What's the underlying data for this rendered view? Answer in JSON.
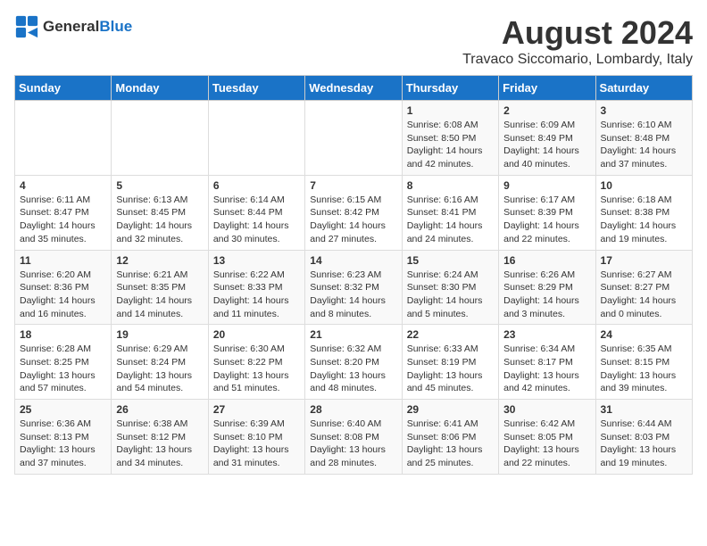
{
  "logo": {
    "text_general": "General",
    "text_blue": "Blue"
  },
  "header": {
    "month_year": "August 2024",
    "location": "Travaco Siccomario, Lombardy, Italy"
  },
  "days_of_week": [
    "Sunday",
    "Monday",
    "Tuesday",
    "Wednesday",
    "Thursday",
    "Friday",
    "Saturday"
  ],
  "weeks": [
    [
      {
        "day": "",
        "info": ""
      },
      {
        "day": "",
        "info": ""
      },
      {
        "day": "",
        "info": ""
      },
      {
        "day": "",
        "info": ""
      },
      {
        "day": "1",
        "info": "Sunrise: 6:08 AM\nSunset: 8:50 PM\nDaylight: 14 hours and 42 minutes."
      },
      {
        "day": "2",
        "info": "Sunrise: 6:09 AM\nSunset: 8:49 PM\nDaylight: 14 hours and 40 minutes."
      },
      {
        "day": "3",
        "info": "Sunrise: 6:10 AM\nSunset: 8:48 PM\nDaylight: 14 hours and 37 minutes."
      }
    ],
    [
      {
        "day": "4",
        "info": "Sunrise: 6:11 AM\nSunset: 8:47 PM\nDaylight: 14 hours and 35 minutes."
      },
      {
        "day": "5",
        "info": "Sunrise: 6:13 AM\nSunset: 8:45 PM\nDaylight: 14 hours and 32 minutes."
      },
      {
        "day": "6",
        "info": "Sunrise: 6:14 AM\nSunset: 8:44 PM\nDaylight: 14 hours and 30 minutes."
      },
      {
        "day": "7",
        "info": "Sunrise: 6:15 AM\nSunset: 8:42 PM\nDaylight: 14 hours and 27 minutes."
      },
      {
        "day": "8",
        "info": "Sunrise: 6:16 AM\nSunset: 8:41 PM\nDaylight: 14 hours and 24 minutes."
      },
      {
        "day": "9",
        "info": "Sunrise: 6:17 AM\nSunset: 8:39 PM\nDaylight: 14 hours and 22 minutes."
      },
      {
        "day": "10",
        "info": "Sunrise: 6:18 AM\nSunset: 8:38 PM\nDaylight: 14 hours and 19 minutes."
      }
    ],
    [
      {
        "day": "11",
        "info": "Sunrise: 6:20 AM\nSunset: 8:36 PM\nDaylight: 14 hours and 16 minutes."
      },
      {
        "day": "12",
        "info": "Sunrise: 6:21 AM\nSunset: 8:35 PM\nDaylight: 14 hours and 14 minutes."
      },
      {
        "day": "13",
        "info": "Sunrise: 6:22 AM\nSunset: 8:33 PM\nDaylight: 14 hours and 11 minutes."
      },
      {
        "day": "14",
        "info": "Sunrise: 6:23 AM\nSunset: 8:32 PM\nDaylight: 14 hours and 8 minutes."
      },
      {
        "day": "15",
        "info": "Sunrise: 6:24 AM\nSunset: 8:30 PM\nDaylight: 14 hours and 5 minutes."
      },
      {
        "day": "16",
        "info": "Sunrise: 6:26 AM\nSunset: 8:29 PM\nDaylight: 14 hours and 3 minutes."
      },
      {
        "day": "17",
        "info": "Sunrise: 6:27 AM\nSunset: 8:27 PM\nDaylight: 14 hours and 0 minutes."
      }
    ],
    [
      {
        "day": "18",
        "info": "Sunrise: 6:28 AM\nSunset: 8:25 PM\nDaylight: 13 hours and 57 minutes."
      },
      {
        "day": "19",
        "info": "Sunrise: 6:29 AM\nSunset: 8:24 PM\nDaylight: 13 hours and 54 minutes."
      },
      {
        "day": "20",
        "info": "Sunrise: 6:30 AM\nSunset: 8:22 PM\nDaylight: 13 hours and 51 minutes."
      },
      {
        "day": "21",
        "info": "Sunrise: 6:32 AM\nSunset: 8:20 PM\nDaylight: 13 hours and 48 minutes."
      },
      {
        "day": "22",
        "info": "Sunrise: 6:33 AM\nSunset: 8:19 PM\nDaylight: 13 hours and 45 minutes."
      },
      {
        "day": "23",
        "info": "Sunrise: 6:34 AM\nSunset: 8:17 PM\nDaylight: 13 hours and 42 minutes."
      },
      {
        "day": "24",
        "info": "Sunrise: 6:35 AM\nSunset: 8:15 PM\nDaylight: 13 hours and 39 minutes."
      }
    ],
    [
      {
        "day": "25",
        "info": "Sunrise: 6:36 AM\nSunset: 8:13 PM\nDaylight: 13 hours and 37 minutes."
      },
      {
        "day": "26",
        "info": "Sunrise: 6:38 AM\nSunset: 8:12 PM\nDaylight: 13 hours and 34 minutes."
      },
      {
        "day": "27",
        "info": "Sunrise: 6:39 AM\nSunset: 8:10 PM\nDaylight: 13 hours and 31 minutes."
      },
      {
        "day": "28",
        "info": "Sunrise: 6:40 AM\nSunset: 8:08 PM\nDaylight: 13 hours and 28 minutes."
      },
      {
        "day": "29",
        "info": "Sunrise: 6:41 AM\nSunset: 8:06 PM\nDaylight: 13 hours and 25 minutes."
      },
      {
        "day": "30",
        "info": "Sunrise: 6:42 AM\nSunset: 8:05 PM\nDaylight: 13 hours and 22 minutes."
      },
      {
        "day": "31",
        "info": "Sunrise: 6:44 AM\nSunset: 8:03 PM\nDaylight: 13 hours and 19 minutes."
      }
    ]
  ]
}
